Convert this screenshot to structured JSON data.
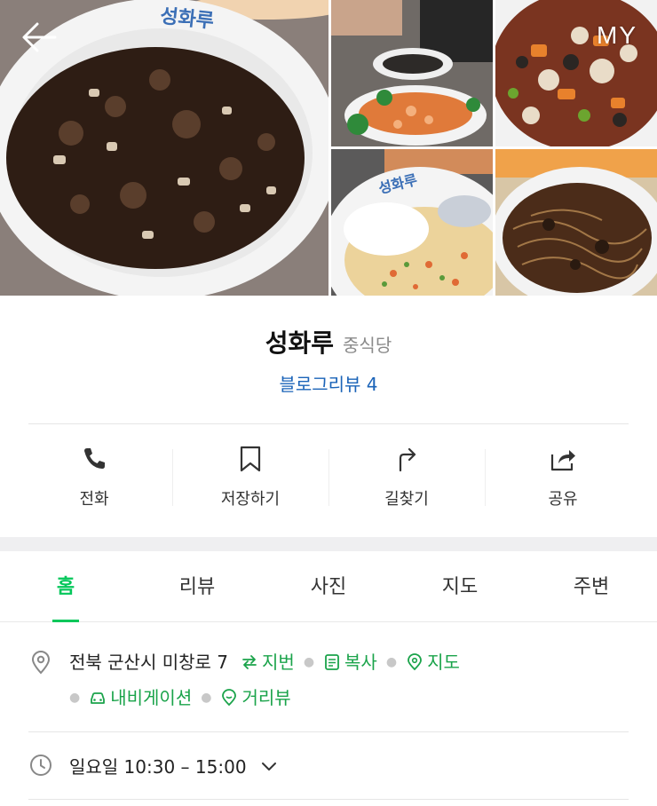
{
  "header": {
    "my_label": "MY",
    "photos": [
      {
        "name": "photo-jjajang-sauce-bowl",
        "bowl_text": "성화루"
      },
      {
        "name": "photo-seafood-dish-table",
        "bowl_text": ""
      },
      {
        "name": "photo-stir-fried-vegetables",
        "bowl_text": ""
      },
      {
        "name": "photo-fried-rice-egg",
        "bowl_text": "성화루"
      },
      {
        "name": "photo-jjajang-noodles",
        "bowl_text": ""
      }
    ]
  },
  "place": {
    "name": "성화루",
    "category": "중식당",
    "blog_review": "블로그리뷰 4"
  },
  "actions": [
    {
      "key": "phone",
      "label": "전화",
      "icon": "phone-icon"
    },
    {
      "key": "save",
      "label": "저장하기",
      "icon": "bookmark-icon"
    },
    {
      "key": "directions",
      "label": "길찾기",
      "icon": "directions-icon"
    },
    {
      "key": "share",
      "label": "공유",
      "icon": "share-icon"
    }
  ],
  "tabs": [
    {
      "label": "홈",
      "active": true
    },
    {
      "label": "리뷰",
      "active": false
    },
    {
      "label": "사진",
      "active": false
    },
    {
      "label": "지도",
      "active": false
    },
    {
      "label": "주변",
      "active": false
    }
  ],
  "info": {
    "address": "전북 군산시 미창로 7",
    "jibeon_label": "지번",
    "copy_label": "복사",
    "map_label": "지도",
    "navigation_label": "내비게이션",
    "street_view_label": "거리뷰",
    "hours": "일요일 10:30 – 15:00"
  },
  "colors": {
    "accent_green": "#03c75a",
    "link_blue": "#1a63b8",
    "link_green": "#1aa34a"
  }
}
